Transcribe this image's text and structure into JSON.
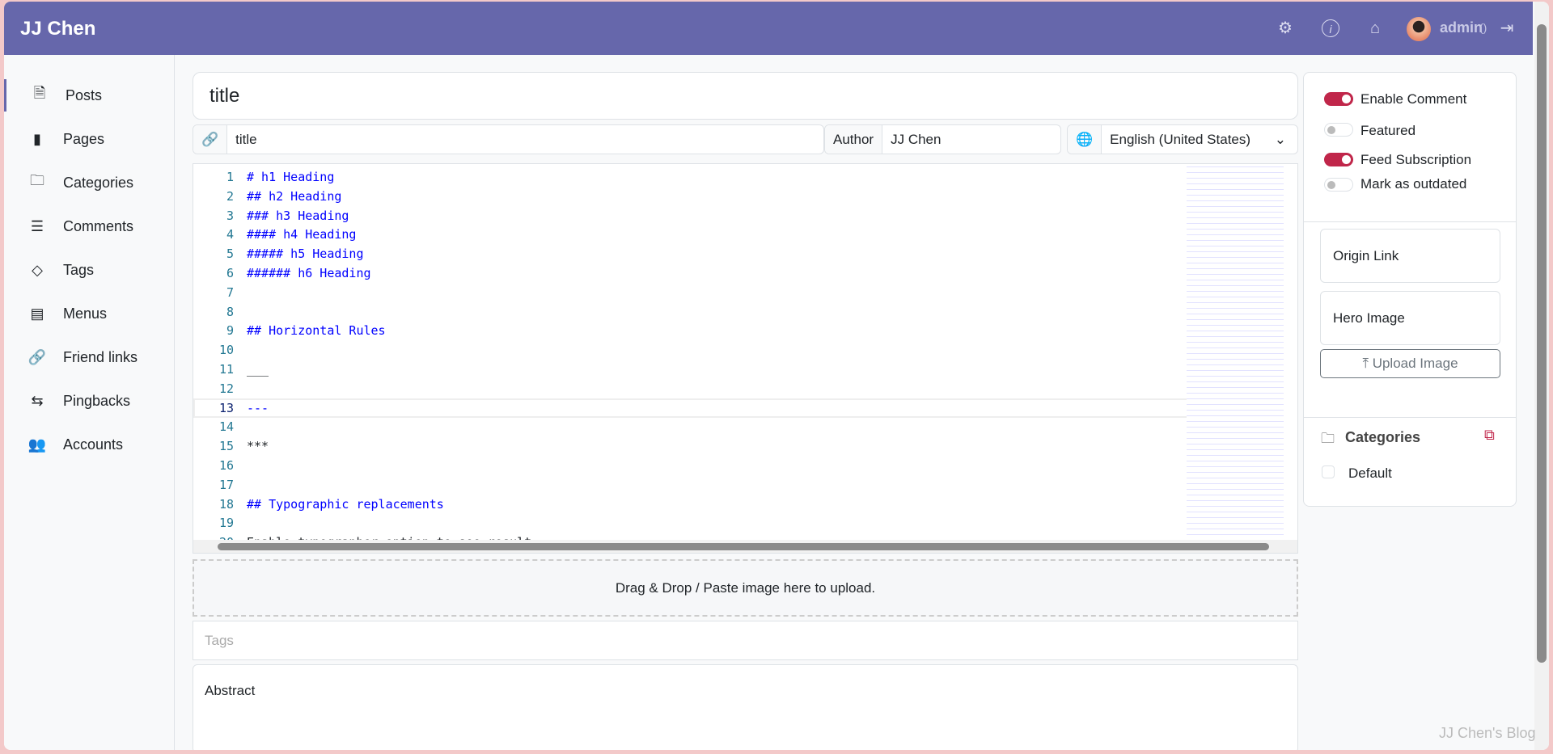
{
  "header": {
    "brand": "JJ Chen",
    "user": "admin",
    "count": "()",
    "icons": [
      "gear-icon",
      "info-icon",
      "home-icon",
      "avatar",
      "logout-icon"
    ]
  },
  "sidebar": {
    "items": [
      {
        "label": "Posts",
        "icon": "file-text-icon",
        "active": true
      },
      {
        "label": "Pages",
        "icon": "file-icon"
      },
      {
        "label": "Categories",
        "icon": "folder-icon"
      },
      {
        "label": "Comments",
        "icon": "comment-icon"
      },
      {
        "label": "Tags",
        "icon": "tag-icon"
      },
      {
        "label": "Menus",
        "icon": "menu-icon"
      },
      {
        "label": "Friend links",
        "icon": "link-icon"
      },
      {
        "label": "Pingbacks",
        "icon": "arrows-icon"
      },
      {
        "label": "Accounts",
        "icon": "people-icon"
      }
    ]
  },
  "post": {
    "title": "title",
    "slug": "title",
    "author_label": "Author",
    "author": "JJ Chen",
    "language": "English (United States)"
  },
  "editor": {
    "lines": [
      "# h1 Heading",
      "## h2 Heading",
      "### h3 Heading",
      "#### h4 Heading",
      "##### h5 Heading",
      "###### h6 Heading",
      "",
      "",
      "## Horizontal Rules",
      "",
      "___",
      "",
      "---",
      "",
      "***",
      "",
      "",
      "## Typographic replacements",
      "",
      "Enable typographer option to see result"
    ],
    "current_line": 13
  },
  "dropzone": "Drag & Drop / Paste image here to upload.",
  "tags_placeholder": "Tags",
  "abstract_placeholder": "Abstract",
  "options": {
    "toggles": [
      {
        "label": "Enable Comment",
        "on": true
      },
      {
        "label": "Featured",
        "on": false
      },
      {
        "label": "Feed Subscription",
        "on": true
      },
      {
        "label": "Mark as outdated",
        "on": false
      }
    ],
    "origin_link": "Origin Link",
    "hero_image": "Hero Image",
    "upload": "Upload Image",
    "categories_title": "Categories",
    "categories": [
      {
        "label": "Default",
        "checked": false
      }
    ]
  },
  "watermark": "JJ Chen's Blog",
  "colors": {
    "header": "#6667ab",
    "accent": "#c0264a",
    "heading_code": "#0000ff",
    "line_number": "#237893"
  }
}
